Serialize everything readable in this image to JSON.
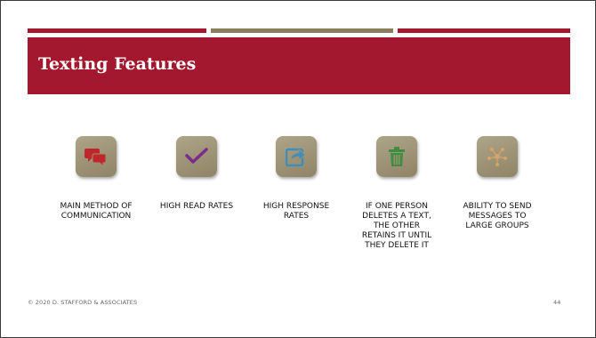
{
  "slide": {
    "title": "Texting Features",
    "footer": "© 2020 D. STAFFORD & ASSOCIATES",
    "page_number": "44"
  },
  "features": [
    {
      "icon": "speech-bubbles-icon",
      "color": "#c0272d",
      "label": "MAIN METHOD OF\nCOMMUNICATION"
    },
    {
      "icon": "checkmark-icon",
      "color": "#7b2a8f",
      "label": "HIGH READ RATES"
    },
    {
      "icon": "share-icon",
      "color": "#3a8fbf",
      "label": "HIGH RESPONSE\nRATES"
    },
    {
      "icon": "trash-icon",
      "color": "#3e8e41",
      "label": "IF ONE PERSON\nDELETES A TEXT,\nTHE OTHER\nRETAINS IT UNTIL\nTHEY DELETE IT"
    },
    {
      "icon": "network-icon",
      "color": "#d4a46a",
      "label": "ABILITY TO SEND\nMESSAGES TO\nLARGE GROUPS"
    }
  ],
  "colors": {
    "accent_red": "#a3182e",
    "accent_taupe": "#8a7e5f"
  }
}
